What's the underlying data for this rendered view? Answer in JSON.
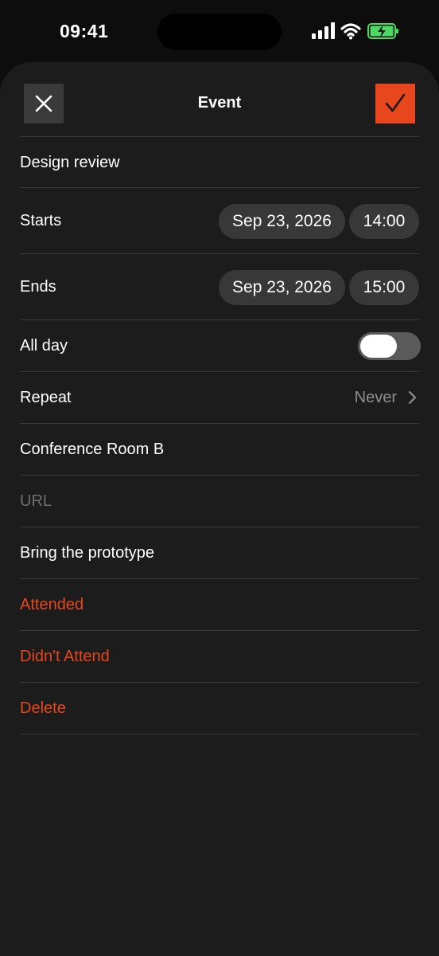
{
  "status_bar": {
    "time": "09:41"
  },
  "header": {
    "title": "Event"
  },
  "form": {
    "title_value": "Design review",
    "starts": {
      "label": "Starts",
      "date": "Sep 23, 2026",
      "time": "14:00"
    },
    "ends": {
      "label": "Ends",
      "date": "Sep 23, 2026",
      "time": "15:00"
    },
    "all_day": {
      "label": "All day",
      "on": false
    },
    "repeat": {
      "label": "Repeat",
      "value": "Never"
    },
    "location_value": "Conference Room B",
    "url_placeholder": "URL",
    "notes_value": "Bring the prototype"
  },
  "actions": {
    "attended": "Attended",
    "didnt_attend": "Didn't Attend",
    "delete": "Delete"
  },
  "colors": {
    "accent": "#e8461c",
    "sheet_bg": "#1c1c1c",
    "pill_bg": "#383838",
    "divider": "#3a3a3a"
  },
  "icons": [
    "signal-icon",
    "wifi-icon",
    "battery-charging-icon",
    "close-icon",
    "checkmark-icon",
    "chevron-right-icon"
  ]
}
